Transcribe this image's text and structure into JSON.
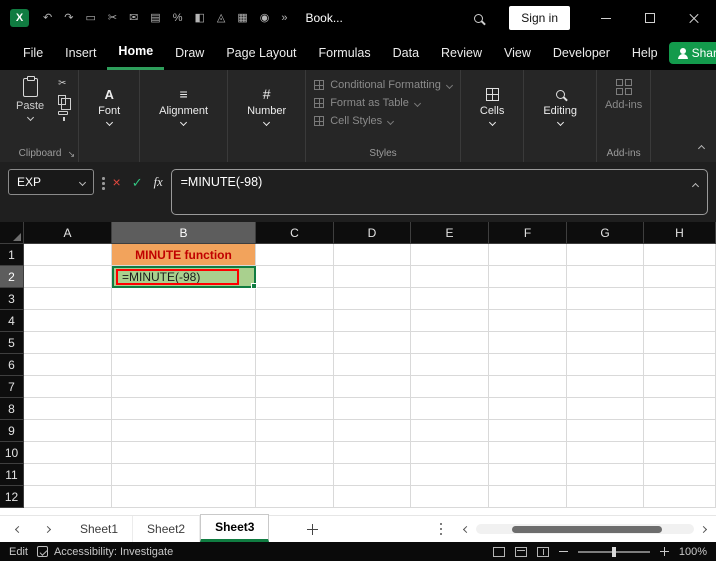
{
  "colors": {
    "excel_green": "#107C41",
    "share_button_green": "#139A4C",
    "active_tab_underline": "#2E9E5B",
    "cell_b1_bg": "#F2A35C",
    "cell_b1_text": "#C00000",
    "cell_b2_bg": "#A9D08E",
    "annotation_red": "#FF0000",
    "selection_border": "#107C41",
    "ribbon_bg": "#262626",
    "titlebar_bg": "#000000"
  },
  "title_bar": {
    "logo_letter": "X",
    "quick_access_icons": [
      {
        "name": "undo-icon",
        "glyph": "↶"
      },
      {
        "name": "redo-icon",
        "glyph": "↷"
      },
      {
        "name": "paste-page-icon",
        "glyph": "▭"
      },
      {
        "name": "cut-icon",
        "glyph": "✂"
      },
      {
        "name": "mail-icon",
        "glyph": "✉"
      },
      {
        "name": "print-icon",
        "glyph": "▤"
      },
      {
        "name": "percent-style-icon",
        "glyph": "%"
      },
      {
        "name": "fill-color-icon",
        "glyph": "◧"
      },
      {
        "name": "beaker-icon",
        "glyph": "◬"
      },
      {
        "name": "borders-icon",
        "glyph": "▦"
      },
      {
        "name": "camera-icon",
        "glyph": "◉"
      },
      {
        "name": "overflow-icon",
        "glyph": "»"
      }
    ],
    "document_title": "Book...",
    "sign_in_label": "Sign in"
  },
  "menu": {
    "tabs": [
      "File",
      "Insert",
      "Home",
      "Draw",
      "Page Layout",
      "Formulas",
      "Data",
      "Review",
      "View",
      "Developer",
      "Help"
    ],
    "active_tab": "Home",
    "share_label": "Share"
  },
  "ribbon": {
    "paste_label": "Paste",
    "clipboard_group_label": "Clipboard",
    "font_icon_glyph": "A",
    "font_label": "Font",
    "alignment_icon_glyph": "≡",
    "alignment_label": "Alignment",
    "number_icon_glyph": "#",
    "number_label": "Number",
    "styles_items": [
      "Conditional Formatting",
      "Format as Table",
      "Cell Styles"
    ],
    "styles_group_label": "Styles",
    "cells_label": "Cells",
    "editing_label": "Editing",
    "addins_label": "Add-ins",
    "addins_group_label": "Add-ins"
  },
  "formula_bar": {
    "name_box_value": "EXP",
    "cancel_glyph": "×",
    "accept_glyph": "✓",
    "fx_label": "fx",
    "formula": "=MINUTE(-98)"
  },
  "grid": {
    "columns": [
      "A",
      "B",
      "C",
      "D",
      "E",
      "F",
      "G",
      "H"
    ],
    "rows": [
      "1",
      "2",
      "3",
      "4",
      "5",
      "6",
      "7",
      "8",
      "9",
      "10",
      "11",
      "12"
    ],
    "selected_column": "B",
    "selected_row": "2",
    "cells": {
      "B1": {
        "text": "MINUTE function",
        "bg": "#F2A35C",
        "color": "#C00000",
        "bold": true,
        "align": "center"
      },
      "B2": {
        "text": "=MINUTE(-98)",
        "bg": "#A9D08E",
        "selected": true,
        "annotation_border": "#FF0000"
      }
    }
  },
  "sheets": {
    "tabs": [
      "Sheet1",
      "Sheet2",
      "Sheet3"
    ],
    "active_tab": "Sheet3"
  },
  "status_bar": {
    "mode": "Edit",
    "accessibility_label": "Accessibility: Investigate",
    "zoom_level": "100%"
  }
}
